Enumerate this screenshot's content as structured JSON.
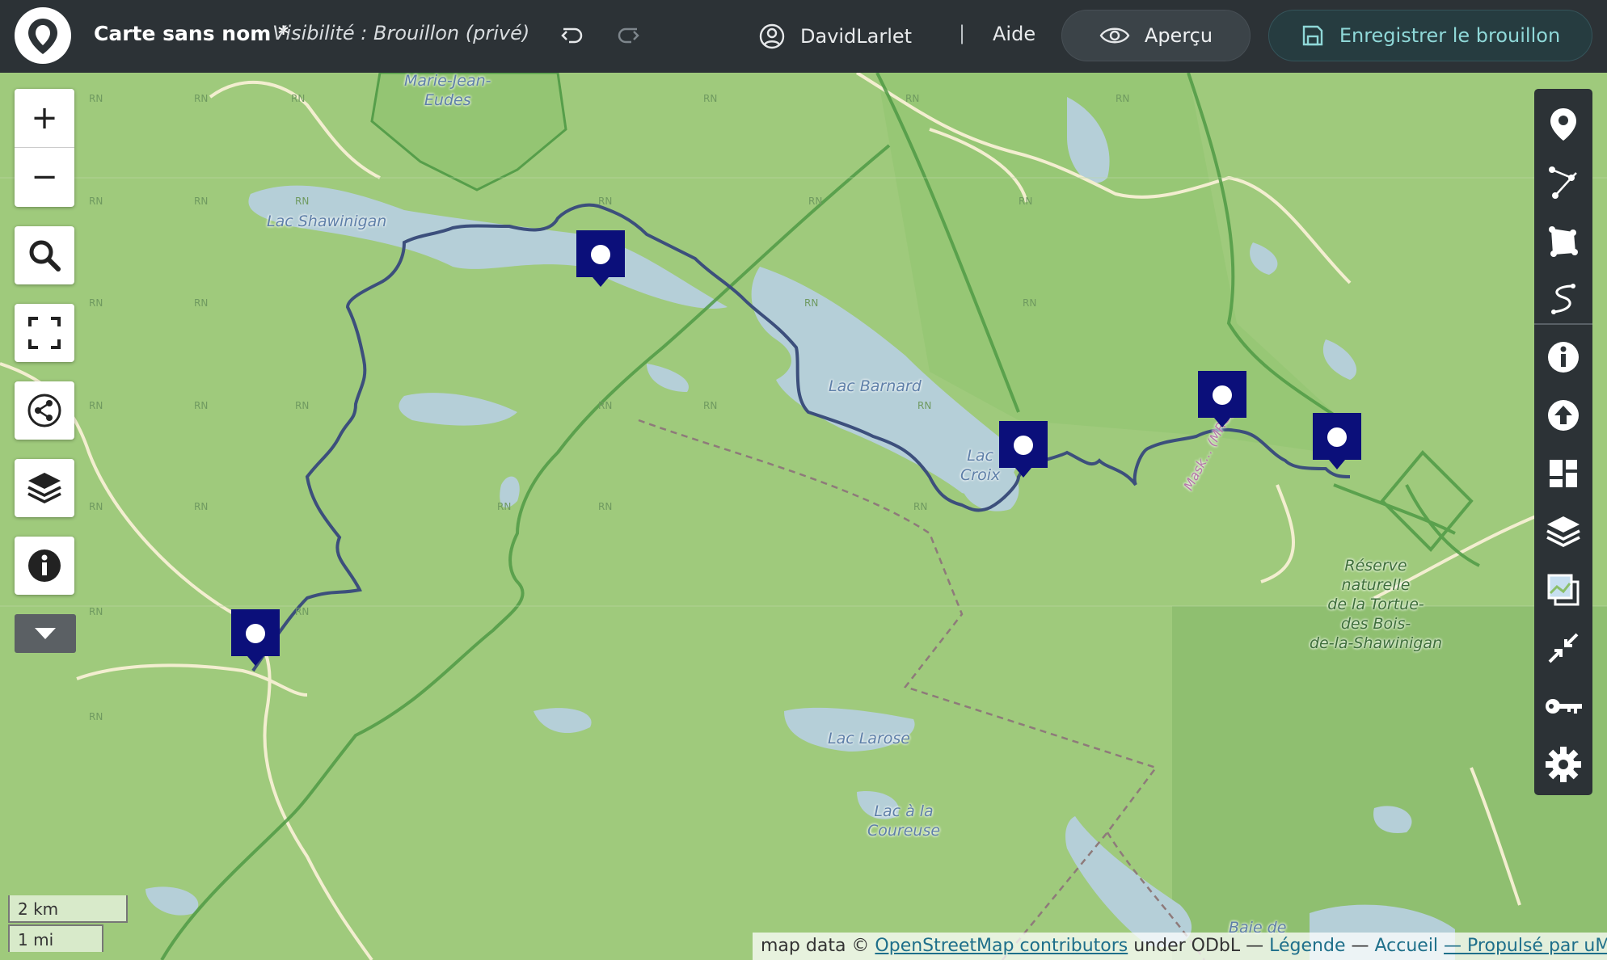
{
  "header": {
    "title": "Carte sans nom *",
    "visibility": "Visibilité : Brouillon (privé)",
    "username": "DavidLarlet",
    "separator": "|",
    "help": "Aide",
    "preview_label": "Aperçu",
    "save_label": "Enregistrer le brouillon"
  },
  "map_labels": {
    "marie_jean_eudes": "Marie-Jean-\nEudes",
    "lac_shawinigan": "Lac Shawinigan",
    "lac_barnard": "Lac Barnard",
    "lac_croix": "Lac\nCroix",
    "mask_mrc": "Mask... (MRC)",
    "reserve": "Réserve\nnaturelle\nde la Tortue-\ndes Bois-\nde-la-Shawinigan",
    "lac_larose": "Lac Larose",
    "lac_coureuse": "Lac à la\nCoureuse",
    "baie": "Baie de",
    "rn": "RN"
  },
  "left_controls": {
    "zoom_in": "+",
    "zoom_out": "−"
  },
  "scale": {
    "metric": "2 km",
    "imperial": "1 mi"
  },
  "attribution": {
    "prefix": "map data © ",
    "osm": "OpenStreetMap contributors",
    "license": " under ODbL — ",
    "legend": "Légende",
    "sep": " — ",
    "home": "Accueil",
    "powered": "— Propulsé par uMap"
  },
  "colors": {
    "header_bg": "#2c3236",
    "map_land": "#9fca7c",
    "water": "#b5cfd8",
    "route": "#3c4f7c",
    "marker": "#0b0f7a",
    "save_text": "#8fd8d8"
  },
  "icons": {
    "toolbar": [
      "marker-icon",
      "line-icon",
      "polygon-icon",
      "route-icon",
      "info-icon",
      "upload-icon",
      "layout-icon",
      "layers-icon",
      "tiles-icon",
      "center-icon",
      "key-icon",
      "gear-icon"
    ],
    "left": [
      "search-icon",
      "fullscreen-icon",
      "share-icon",
      "layers-icon",
      "info-icon",
      "caret-down-icon"
    ]
  }
}
